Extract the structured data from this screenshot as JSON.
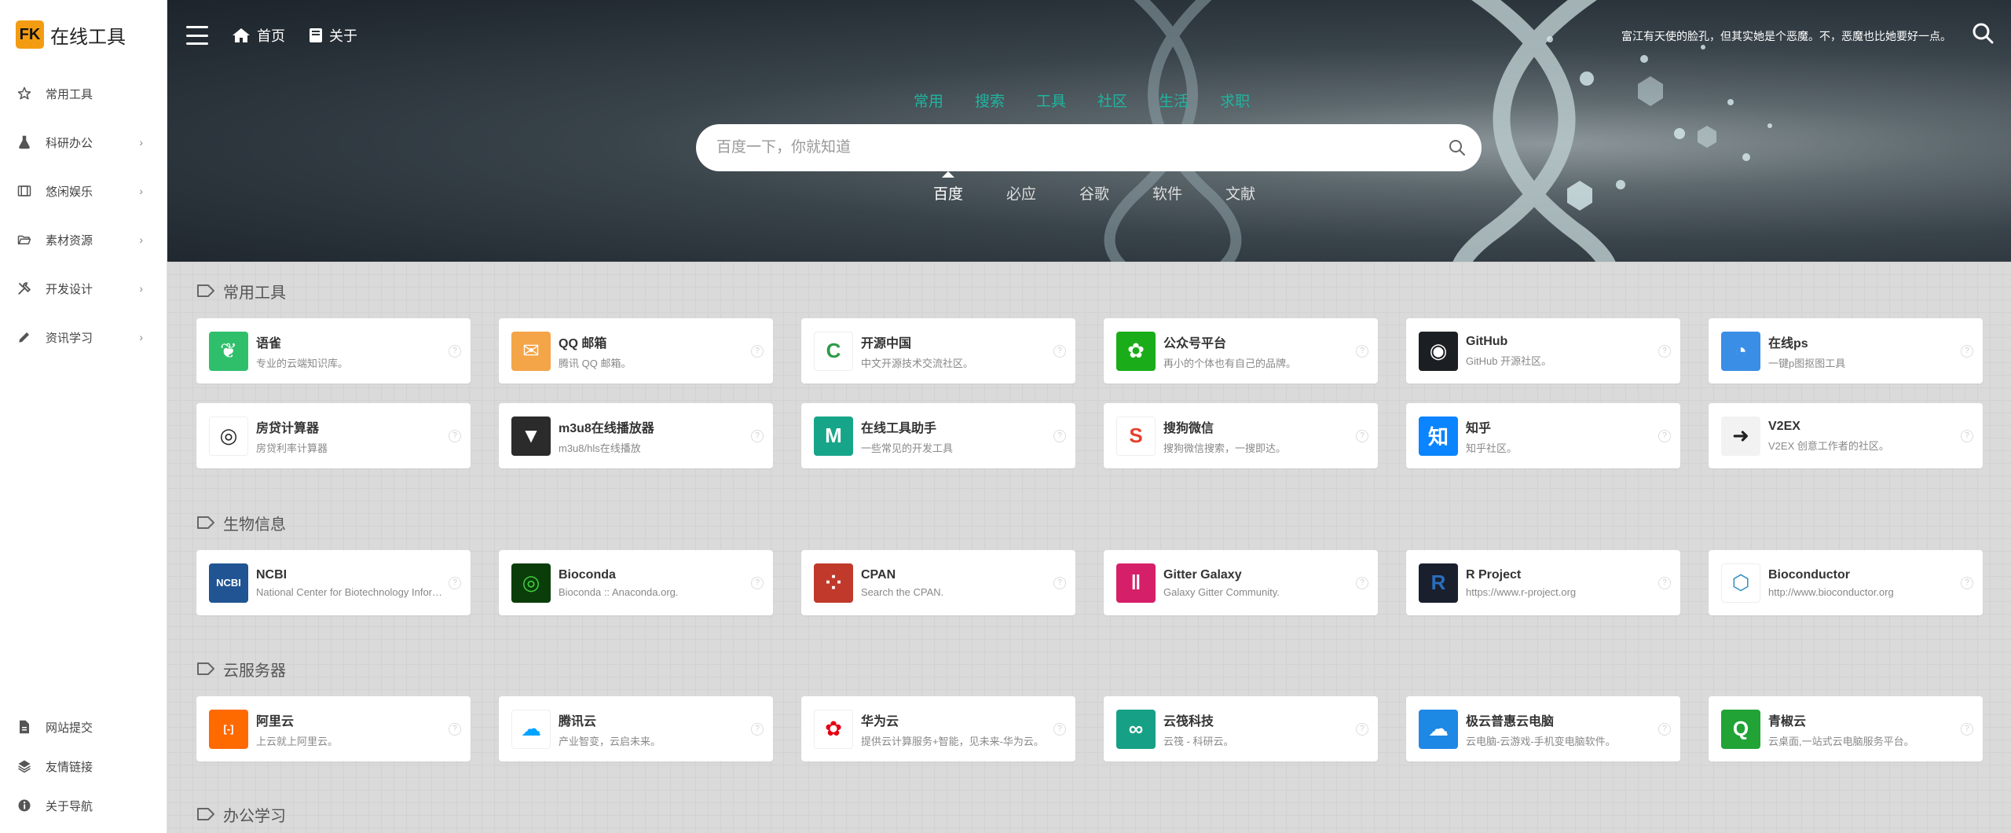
{
  "logo": {
    "badge": "FK",
    "title": "在线工具"
  },
  "sidebar": {
    "items": [
      {
        "label": "常用工具",
        "icon": "star-icon",
        "has_children": false
      },
      {
        "label": "科研办公",
        "icon": "flask-icon",
        "has_children": true
      },
      {
        "label": "悠闲娱乐",
        "icon": "film-icon",
        "has_children": true
      },
      {
        "label": "素材资源",
        "icon": "folder-open-icon",
        "has_children": true
      },
      {
        "label": "开发设计",
        "icon": "tools-icon",
        "has_children": true
      },
      {
        "label": "资讯学习",
        "icon": "pen-icon",
        "has_children": true
      }
    ],
    "bottom_items": [
      {
        "label": "网站提交",
        "icon": "file-icon"
      },
      {
        "label": "友情链接",
        "icon": "layers-icon"
      },
      {
        "label": "关于导航",
        "icon": "info-icon"
      }
    ],
    "chevron": "›"
  },
  "header": {
    "home_label": "首页",
    "about_label": "关于",
    "motto": "富江有天使的脸孔，但其实她是个恶魔。不，恶魔也比她要好一点。"
  },
  "search": {
    "category_tabs": [
      "常用",
      "搜索",
      "工具",
      "社区",
      "生活",
      "求职"
    ],
    "placeholder": "百度一下，你就知道",
    "engines": [
      "百度",
      "必应",
      "谷歌",
      "软件",
      "文献"
    ],
    "active_engine": "百度"
  },
  "sections": [
    {
      "title": "常用工具",
      "cards": [
        {
          "title": "语雀",
          "desc": "专业的云端知识库。",
          "color": "#2fbf6b",
          "glyph": "❦"
        },
        {
          "title": "QQ 邮箱",
          "desc": "腾讯 QQ 邮箱。",
          "color": "#f4a548",
          "glyph": "✉"
        },
        {
          "title": "开源中国",
          "desc": "中文开源技术交流社区。",
          "color": "#ffffff",
          "glyph": "C",
          "fg": "#2d9b47"
        },
        {
          "title": "公众号平台",
          "desc": "再小的个体也有自己的品牌。",
          "color": "#1aad19",
          "glyph": "✿"
        },
        {
          "title": "GitHub",
          "desc": "GitHub 开源社区。",
          "color": "#1b1f23",
          "glyph": "◉"
        },
        {
          "title": "在线ps",
          "desc": "一键p图抠图工具",
          "color": "#3a8ee6",
          "glyph": "◔"
        },
        {
          "title": "房贷计算器",
          "desc": "房贷利率计算器",
          "color": "#ffffff",
          "glyph": "◎",
          "fg": "#222"
        },
        {
          "title": "m3u8在线播放器",
          "desc": "m3u8/hls在线播放",
          "color": "#2b2b2b",
          "glyph": "▼"
        },
        {
          "title": "在线工具助手",
          "desc": "一些常见的开发工具",
          "color": "#17a589",
          "glyph": "M"
        },
        {
          "title": "搜狗微信",
          "desc": "搜狗微信搜索，一搜即达。",
          "color": "#ffffff",
          "glyph": "S",
          "fg": "#e8412c"
        },
        {
          "title": "知乎",
          "desc": "知乎社区。",
          "color": "#0a84ff",
          "glyph": "知"
        },
        {
          "title": "V2EX",
          "desc": "V2EX 创意工作者的社区。",
          "color": "#f2f2f2",
          "glyph": "➜",
          "fg": "#222"
        }
      ]
    },
    {
      "title": "生物信息",
      "cards": [
        {
          "title": "NCBI",
          "desc": "National Center for Biotechnology Information",
          "color": "#205493",
          "glyph": "NCBI"
        },
        {
          "title": "Bioconda",
          "desc": "Bioconda :: Anaconda.org.",
          "color": "#0a3d0a",
          "glyph": "◎",
          "fg": "#3fd13f"
        },
        {
          "title": "CPAN",
          "desc": "Search the CPAN.",
          "color": "#c0392b",
          "glyph": "⁘"
        },
        {
          "title": "Gitter Galaxy",
          "desc": "Galaxy Gitter Community.",
          "color": "#d61f69",
          "glyph": "‖"
        },
        {
          "title": "R Project",
          "desc": "https://www.r-project.org",
          "color": "#1a1f2e",
          "glyph": "R",
          "fg": "#2a6ebb"
        },
        {
          "title": "Bioconductor",
          "desc": "http://www.bioconductor.org",
          "color": "#ffffff",
          "glyph": "⬡",
          "fg": "#2a8bbf"
        }
      ]
    },
    {
      "title": "云服务器",
      "cards": [
        {
          "title": "阿里云",
          "desc": "上云就上阿里云。",
          "color": "#ff6a00",
          "glyph": "[-]"
        },
        {
          "title": "腾讯云",
          "desc": "产业智变，云启未来。",
          "color": "#ffffff",
          "glyph": "☁",
          "fg": "#00a3ff"
        },
        {
          "title": "华为云",
          "desc": "提供云计算服务+智能，见未来-华为云。",
          "color": "#ffffff",
          "glyph": "✿",
          "fg": "#e60012"
        },
        {
          "title": "云筏科技",
          "desc": "云筏 - 科研云。",
          "color": "#16a085",
          "glyph": "∞"
        },
        {
          "title": "极云普惠云电脑",
          "desc": "云电脑-云游戏-手机变电脑软件。",
          "color": "#1e88e5",
          "glyph": "☁"
        },
        {
          "title": "青椒云",
          "desc": "云桌面,一站式云电脑服务平台。",
          "color": "#21a336",
          "glyph": "Q"
        }
      ]
    },
    {
      "title": "办公学习",
      "cards": []
    }
  ]
}
